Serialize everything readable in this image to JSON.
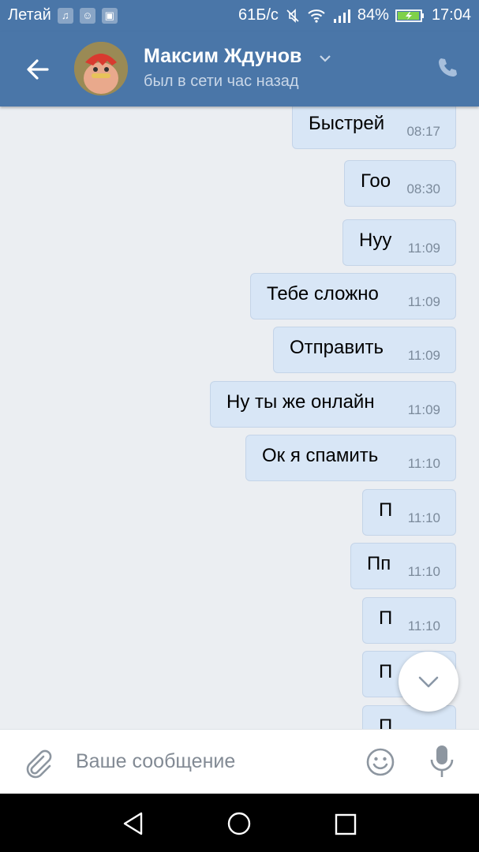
{
  "status_bar": {
    "carrier": "Летай",
    "speed": "61Б/с",
    "battery": "84%",
    "time": "17:04",
    "icons": [
      "music-icon",
      "app-icon",
      "image-icon",
      "mute-icon",
      "wifi-icon",
      "signal-icon",
      "battery-icon"
    ]
  },
  "header": {
    "contact_name": "Максим Ждунов",
    "status": "был в сети час назад",
    "colors": {
      "bar": "#4a76a8"
    }
  },
  "messages": [
    {
      "text": "Быстрей",
      "time": "08:17"
    },
    {
      "text": "Гоо",
      "time": "08:30"
    },
    {
      "text": "Нуу",
      "time": "11:09"
    },
    {
      "text": "Тебе сложно",
      "time": "11:09"
    },
    {
      "text": "Отправить",
      "time": "11:09"
    },
    {
      "text": "Ну ты же онлайн",
      "time": "11:09"
    },
    {
      "text": "Ок я спамить",
      "time": "11:10"
    },
    {
      "text": "П",
      "time": "11:10"
    },
    {
      "text": "Пп",
      "time": "11:10"
    },
    {
      "text": "П",
      "time": "11:10"
    },
    {
      "text": "П",
      "time": ""
    },
    {
      "text": "П",
      "time": ""
    }
  ],
  "composer": {
    "placeholder": "Ваше сообщение"
  }
}
